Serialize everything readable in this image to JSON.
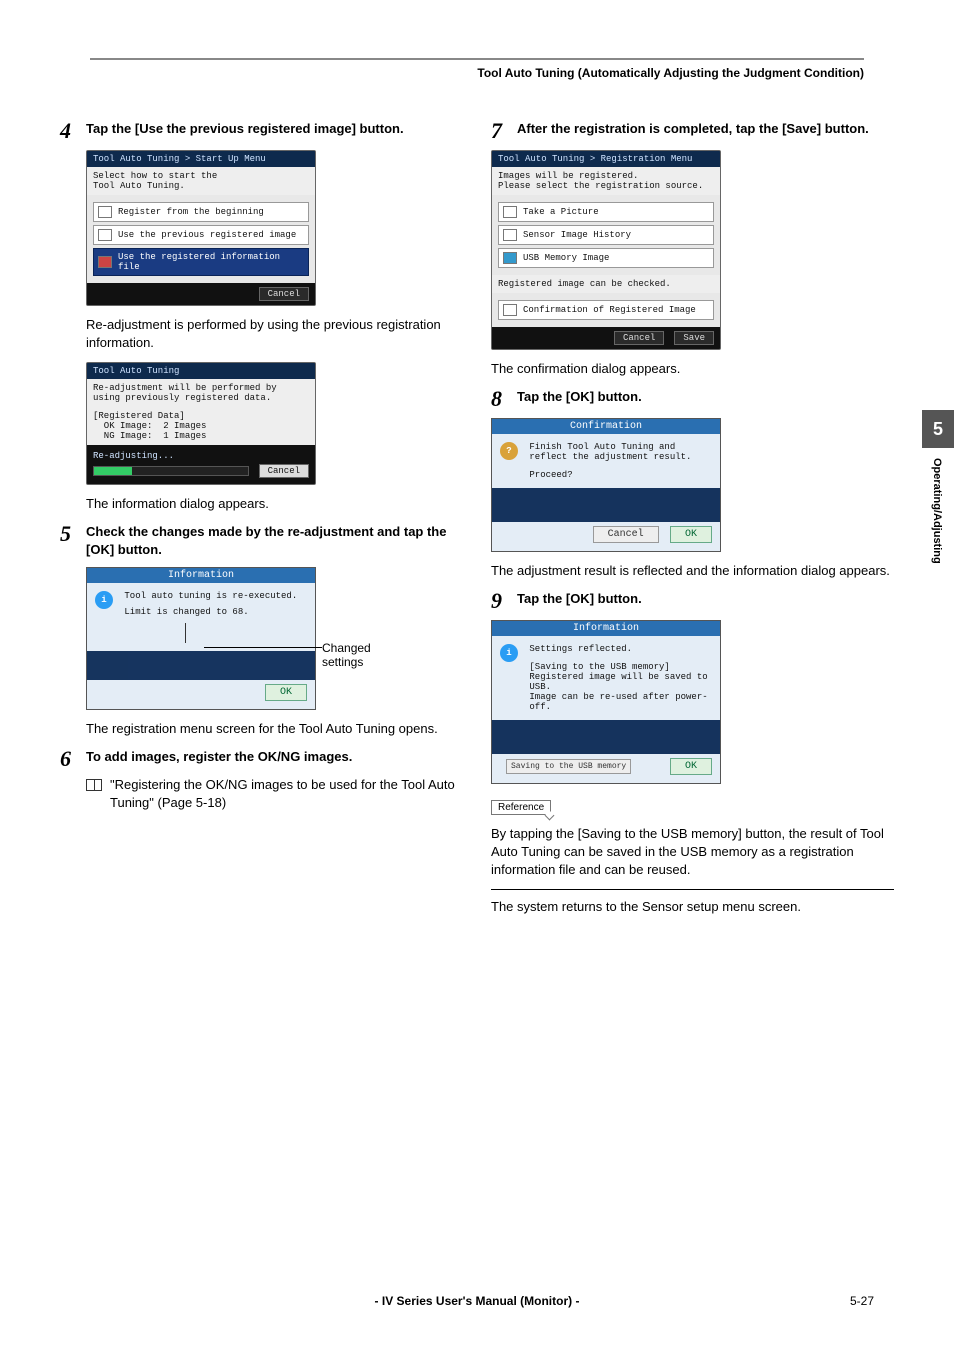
{
  "header": {
    "title": "Tool Auto Tuning (Automatically Adjusting the Judgment Condition)"
  },
  "side_tab": {
    "number": "5",
    "label": "Operating/Adjusting"
  },
  "left": {
    "step4": {
      "num": "4",
      "text": "Tap the [Use the previous registered image] button.",
      "shot_title": "Tool Auto Tuning > Start Up Menu",
      "shot_sub": "Select how to start the\nTool Auto Tuning.",
      "row1": "Register from the beginning",
      "row2": "Use the previous registered image",
      "row3": "Use the registered information file",
      "cancel": "Cancel",
      "after": "Re-adjustment is performed by using the previous registration information.",
      "shot2_title": "Tool Auto Tuning",
      "shot2_line1": "Re-adjustment will be performed by using previously registered data.",
      "shot2_reg": "[Registered Data]\n  OK Image:  2 Images\n  NG Image:  1 Images",
      "shot2_status": "Re-adjusting...",
      "shot2_cancel": "Cancel",
      "after2": "The information dialog appears."
    },
    "step5": {
      "num": "5",
      "text": "Check the changes made by the re-adjustment and tap the [OK] button.",
      "dlg_title": "Information",
      "dlg_line1": "Tool auto tuning is re-executed.",
      "dlg_line2": "Limit is changed to 68.",
      "dlg_ok": "OK",
      "callout": "Changed settings",
      "after": "The registration menu screen for the Tool Auto Tuning opens."
    },
    "step6": {
      "num": "6",
      "text": "To add images, register the OK/NG images.",
      "ref": "\"Registering the OK/NG images to be used for the Tool Auto Tuning\" (Page 5-18)"
    }
  },
  "right": {
    "step7": {
      "num": "7",
      "text": "After the registration is completed, tap the [Save] button.",
      "shot_title": "Tool Auto Tuning > Registration Menu",
      "shot_sub": "Images will be registered.\nPlease select the registration source.",
      "row1": "Take a Picture",
      "row2": "Sensor Image History",
      "row3": "USB Memory Image",
      "mid": "Registered image can be checked.",
      "row4": "Confirmation of Registered Image",
      "cancel": "Cancel",
      "save": "Save",
      "after": "The confirmation dialog appears."
    },
    "step8": {
      "num": "8",
      "text": "Tap the [OK] button.",
      "dlg_title": "Confirmation",
      "dlg_line1": "Finish Tool Auto Tuning and reflect the adjustment result.",
      "dlg_line2": "Proceed?",
      "dlg_cancel": "Cancel",
      "dlg_ok": "OK",
      "after": "The adjustment result is reflected and the information dialog appears."
    },
    "step9": {
      "num": "9",
      "text": "Tap the [OK] button.",
      "dlg_title": "Information",
      "dlg_line1": "Settings reflected.",
      "dlg_line2": "[Saving to the USB memory]\nRegistered image will be saved to USB.\nImage can be re-used after power-off.",
      "dlg_btn_save": "Saving to the USB memory",
      "dlg_ok": "OK",
      "ref_label": "Reference",
      "ref_text": "By tapping the [Saving to the USB memory] button, the result of Tool Auto Tuning can be saved in the USB memory as a registration information file and can be reused.",
      "after": "The system returns to the Sensor setup menu screen."
    }
  },
  "footer": {
    "center": "- IV Series User's Manual (Monitor) -",
    "page": "5-27"
  }
}
